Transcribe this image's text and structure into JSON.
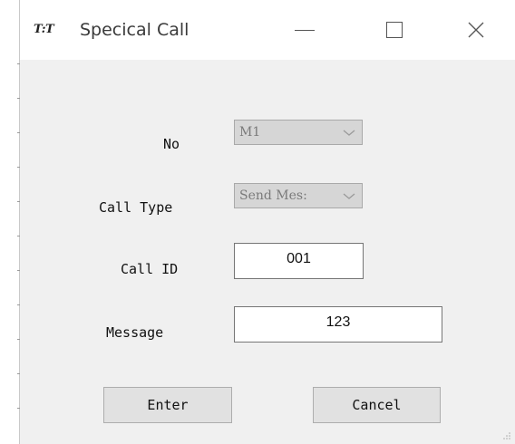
{
  "window": {
    "title": "Specical Call",
    "icon_text": "T:T",
    "controls": [
      "minimize-icon",
      "maximize-icon",
      "close-icon"
    ]
  },
  "form": {
    "no": {
      "label": "No",
      "value": "M1"
    },
    "call_type": {
      "label": "Call Type",
      "value": "Send Mes:"
    },
    "call_id": {
      "label": "Call ID",
      "value": "001"
    },
    "message": {
      "label": "Message",
      "value": "123"
    }
  },
  "buttons": {
    "enter": "Enter",
    "cancel": "Cancel"
  },
  "colors": {
    "dialog_bg": "#f0f0f0",
    "titlebar_bg": "#ffffff",
    "disabled_combo_bg": "#d6d6d6",
    "button_bg": "#e1e1e1"
  }
}
